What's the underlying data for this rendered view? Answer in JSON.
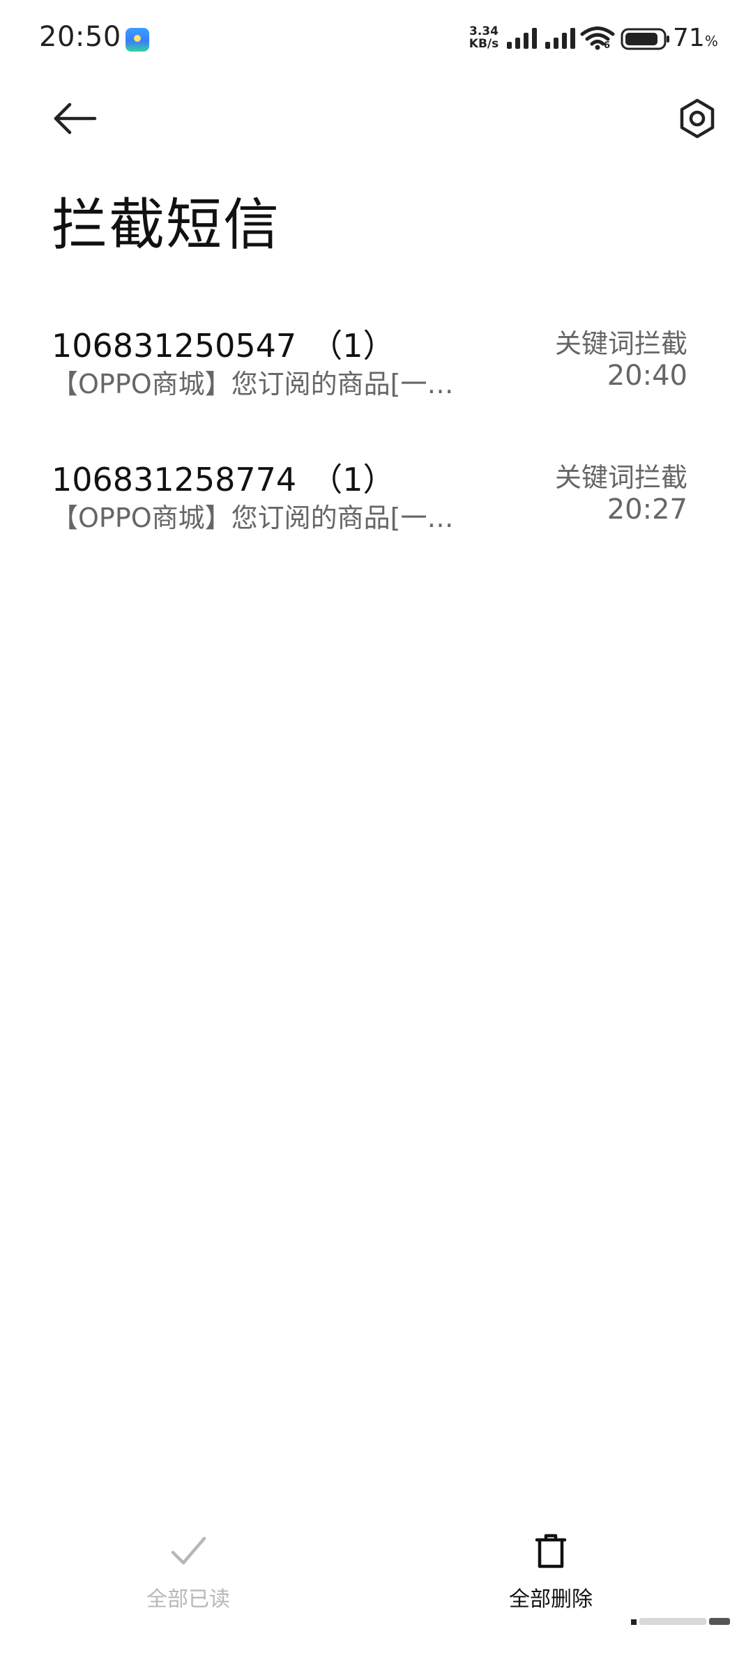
{
  "status_bar": {
    "time": "20:50",
    "net_speed_value": "3.34",
    "net_speed_unit": "KB/s",
    "wifi_badge": "6",
    "battery_level": "71",
    "battery_unit": "%",
    "icons": [
      "app-notification-icon",
      "signal-icon",
      "signal-icon",
      "wifi-icon",
      "battery-icon"
    ]
  },
  "header": {
    "back_icon": "back-arrow-icon",
    "settings_icon": "settings-icon",
    "title": "拦截短信"
  },
  "messages": [
    {
      "sender": "106831250547",
      "count": "（1）",
      "preview": "【OPPO商城】您订阅的商品[一…",
      "reason": "关键词拦截",
      "time": "20:40"
    },
    {
      "sender": "106831258774",
      "count": "（1）",
      "preview": "【OPPO商城】您订阅的商品[一…",
      "reason": "关键词拦截",
      "time": "20:27"
    }
  ],
  "bottom_actions": {
    "mark_all_read": {
      "label": "全部已读",
      "icon": "check-icon",
      "enabled": false
    },
    "delete_all": {
      "label": "全部删除",
      "icon": "trash-icon",
      "enabled": true
    }
  },
  "colors": {
    "background": "#ffffff",
    "primary_text": "#111111",
    "secondary_text": "#666666",
    "disabled_text": "#b7b7b7"
  }
}
